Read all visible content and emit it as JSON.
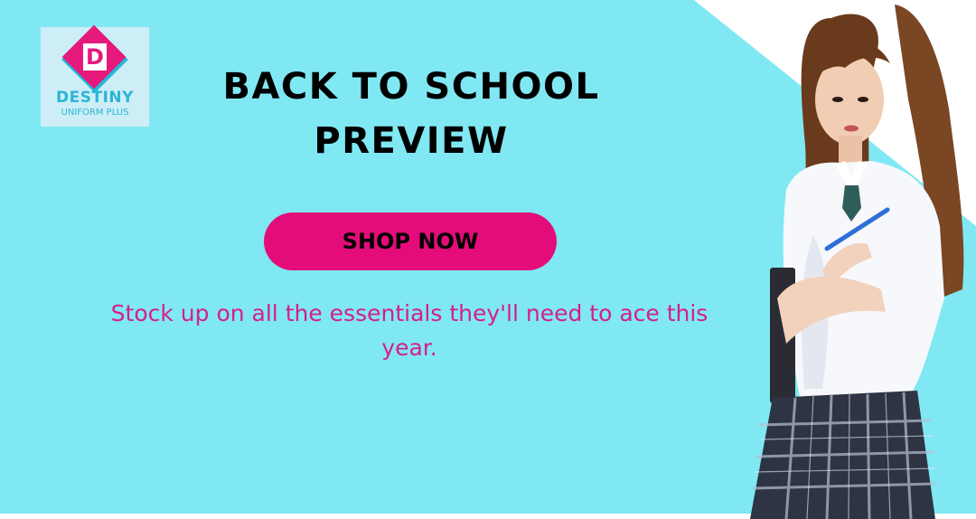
{
  "logo": {
    "letter": "D",
    "name": "DESTINY",
    "subtitle": "UNIFORM PLUS"
  },
  "headline": {
    "line1": "BACK TO SCHOOL",
    "line2": "PREVIEW"
  },
  "cta": {
    "label": "SHOP NOW"
  },
  "tagline": "Stock up on all the essentials they'll need to ace this year.",
  "colors": {
    "background": "#80e8f2",
    "accent": "#e40c7a",
    "tagline": "#d4208b",
    "logo_text": "#2bb5d6"
  }
}
